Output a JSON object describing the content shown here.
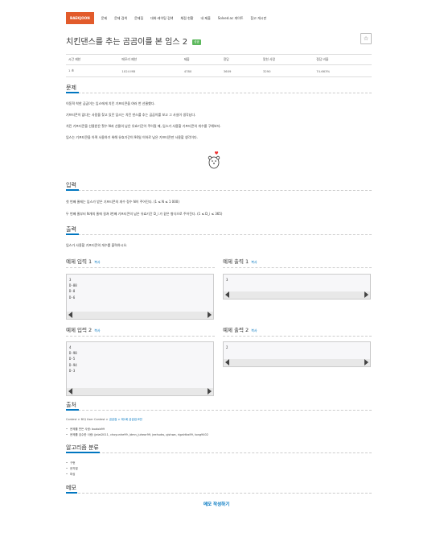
{
  "nav": {
    "logo": "BAEKJOON",
    "items": [
      "문제",
      "문제 검색",
      "문제집",
      "대회·레이팅 검색",
      "채점 현황",
      "내 제출",
      "Solved.ac 게이트",
      "참고 게시판"
    ]
  },
  "problem": {
    "title": "치킨댄스를 추는 곰곰이를 본 임스 2",
    "badge": "성공",
    "star": "☆"
  },
  "stats": {
    "headers": [
      "시간 제한",
      "메모리 제한",
      "제출",
      "정답",
      "맞힌 사람",
      "정답 비율"
    ],
    "values": [
      "1 초",
      "1024 MB",
      "4780",
      "3609",
      "3290",
      "74.663%"
    ]
  },
  "sections": {
    "problem": "문제",
    "input": "입력",
    "output": "출력",
    "source": "출처",
    "algorithm": "알고리즘 분류",
    "memo": "메모"
  },
  "description": [
    "이동혁 착한 곰곰이는 임스에게 치킨 기프티콘을 여러 번 선물했다.",
    "기프티콘이 없다는 사람을 찾고 있던 임스는 치킨 댄스를 추는 곰곰이를 보고 그 사실이 생각났다.",
    "치킨 기프티콘을 선물받은 횟수 N과 선물의 남은 유효기간이 주어질 때, 임스가 사용할 기프티콘의 개수를 구해보자.",
    "임스는 기프티콘을 아껴 사용하기 위해 유효기간이 90일 이하로 남은 기프티콘만 사용할 생각이다."
  ],
  "input_text": [
    "첫 번째 줄에는 임스가 받은 기프티콘의 개수 정수 N이 주어진다. (1 ≤ N ≤ 1 000)",
    "두 번째 줄부터 N개의 줄에 걸쳐 i번째 기프티콘의 남은 유효기간 D_i 가 같은 형식으로 주어진다. (1 ≤ D_i ≤ 365)"
  ],
  "output_text": "임스가 사용할 기프티콘의 개수를 출력하시오.",
  "examples": {
    "copy_label": "복사",
    "in1_title": "예제 입력 1",
    "out1_title": "예제 출력 1",
    "in2_title": "예제 입력 2",
    "out2_title": "예제 출력 2",
    "in1": "3\nD-88\nD-8\nD-6",
    "out1": "3",
    "in2": "4\nD-98\nD-5\nD-94\nD-3",
    "out2": "2"
  },
  "source": {
    "prefix": "Contest > BOJ User Contest > ",
    "link": "곰곰컵 > 제1회 곰곰컵 B번",
    "items": [
      "문제를 만든 사람: bozlob99",
      "문제를 검수한 사람: jjelat2011, choyunhe99, jdmn_juheor99, jeehudw, pjshwa, rlgalrtbs99, tong9402"
    ]
  },
  "algorithms": [
    "구현",
    "문자열",
    "파싱"
  ],
  "memo_button": "메모 작성하기",
  "colors": {
    "logo": "#e25b2b",
    "accent": "#0076c0",
    "badge": "#5cb85c"
  }
}
